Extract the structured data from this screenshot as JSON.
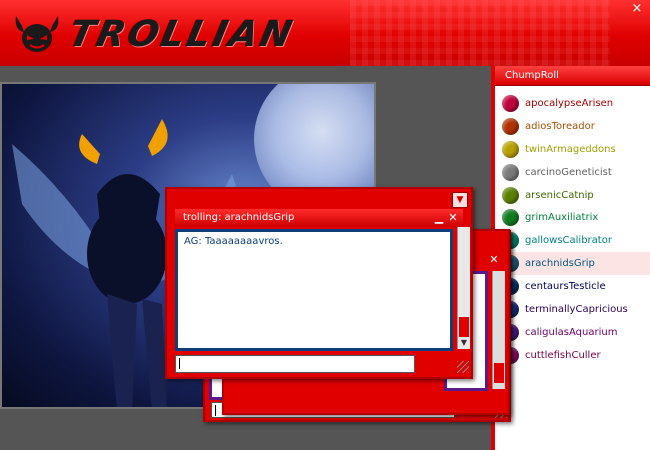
{
  "app": {
    "title": "TROLLIAN"
  },
  "chumproll": {
    "title": "ChumpRoll",
    "items": [
      {
        "label": "apocalypseArisen",
        "color": "#a10000",
        "dot": "#c0003c"
      },
      {
        "label": "adiosToreador",
        "color": "#a15000",
        "dot": "#b03000"
      },
      {
        "label": "twinArmageddons",
        "color": "#a1a100",
        "dot": "#b8a000"
      },
      {
        "label": "carcinoGeneticist",
        "color": "#626262",
        "dot": "#7a7a7a"
      },
      {
        "label": "arsenicCatnip",
        "color": "#416600",
        "dot": "#5a8000"
      },
      {
        "label": "grimAuxiliatrix",
        "color": "#008141",
        "dot": "#107a20"
      },
      {
        "label": "gallowsCalibrator",
        "color": "#008282",
        "dot": "#008a70"
      },
      {
        "label": "arachnidsGrip",
        "color": "#005682",
        "dot": "#1e5a7a",
        "selected": true
      },
      {
        "label": "centaursTesticle",
        "color": "#000056",
        "dot": "#0a2f6b"
      },
      {
        "label": "terminallyCapricious",
        "color": "#2b0057",
        "dot": "#1a2f80"
      },
      {
        "label": "caligulasAquarium",
        "color": "#6a006a",
        "dot": "#4a1a80"
      },
      {
        "label": "cuttlefishCuller",
        "color": "#77003c",
        "dot": "#8a1060"
      }
    ]
  },
  "chat": {
    "title": "trolling: arachnidsGrip",
    "messages": [
      "AG: Taaaaaaaavros."
    ],
    "input_value": "",
    "minimize_glyph": "▁",
    "close_glyph": "✕",
    "dropdown_glyph": "▼"
  },
  "window": {
    "close_glyph": "×"
  }
}
